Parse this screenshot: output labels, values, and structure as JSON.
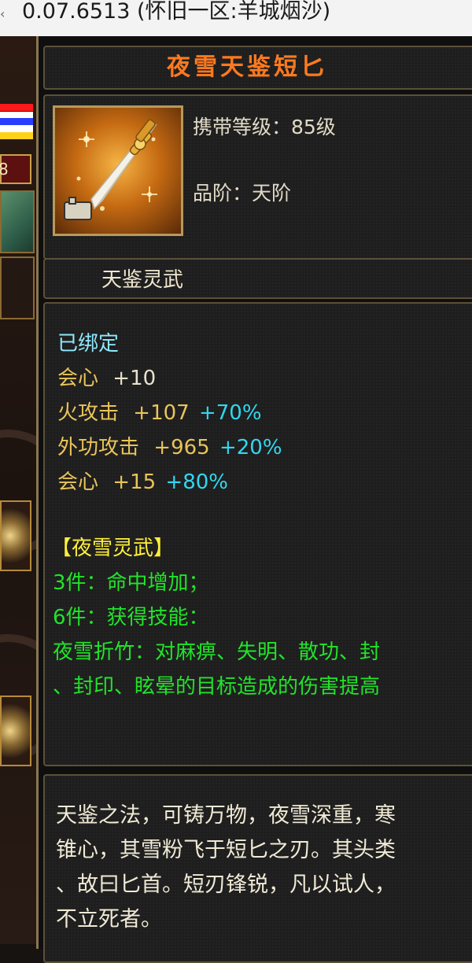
{
  "window": {
    "title": "0.07.6513 (怀旧一区:羊城烟沙)"
  },
  "sidebar": {
    "level_badge": "8",
    "status_bar_colors": [
      "#ff1a1a",
      "#ffffff",
      "#2a3dff",
      "#ffffff",
      "#ffd21a"
    ],
    "icons": [
      "map-thumbnail",
      "skill-slot",
      "skill-slot"
    ]
  },
  "item": {
    "name": "夜雪天鉴短匕",
    "icon": "dagger-icon",
    "carry_level": "携带等级：85级",
    "grade": "品阶：天阶",
    "set_title": "天鉴灵武"
  },
  "attributes": {
    "bound": "已绑定",
    "lines": [
      {
        "name": "会心",
        "value": "+10",
        "bonus": ""
      },
      {
        "name": "火攻击",
        "value": "+107",
        "bonus": "+70%"
      },
      {
        "name": "外功攻击",
        "value": "+965",
        "bonus": "+20%"
      },
      {
        "name": "会心",
        "value": "+15",
        "bonus": "+80%"
      }
    ]
  },
  "set_bonus": {
    "title": "【夜雪灵武】",
    "piece3": "3件：命中增加；",
    "piece6": "6件：获得技能：",
    "skill_line1": "夜雪折竹：对麻痹、失明、散功、封",
    "skill_line2": "、封印、眩晕的目标造成的伤害提高"
  },
  "lore": {
    "line1": "天鉴之法，可铸万物，夜雪深重，寒",
    "line2": "锥心，其雪粉飞于短匕之刃。其头类",
    "line3": "、故曰匕首。短刃锋锐，凡以试人，",
    "line4": "不立死者。"
  },
  "colors": {
    "title": "#ff7a1e",
    "bonus_percent": "#31d7f0",
    "attribute": "#e9c45a",
    "set_name": "#fff03a",
    "set_text": "#22e32a",
    "bound": "#8fe8ff"
  }
}
